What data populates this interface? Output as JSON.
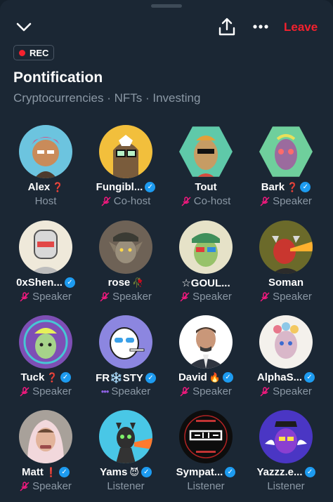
{
  "header": {
    "leave_label": "Leave",
    "rec_label": "REC"
  },
  "space": {
    "title": "Pontification",
    "topics": "Cryptocurrencies · NFTs · Investing"
  },
  "icons": {
    "collapse": "chevron-down-icon",
    "share": "share-icon",
    "more": "more-dots-icon",
    "muted": "mic-off-icon",
    "verified": "verified-badge-icon"
  },
  "colors": {
    "leave": "#f4212e",
    "muted_mic": "#f91880",
    "verified": "#1d9bf0",
    "speaking": "#8e62e3"
  },
  "participants": [
    {
      "name": "Alex",
      "emoji": "❓",
      "verified": false,
      "role": "Host",
      "mic": "none"
    },
    {
      "name": "Fungibl...",
      "emoji": "",
      "verified": true,
      "role": "Co-host",
      "mic": "muted"
    },
    {
      "name": "Tout",
      "emoji": "",
      "verified": false,
      "role": "Co-host",
      "mic": "muted"
    },
    {
      "name": "Bark",
      "emoji": "❓",
      "verified": true,
      "role": "Speaker",
      "mic": "muted"
    },
    {
      "name": "0xShen...",
      "emoji": "",
      "verified": true,
      "role": "Speaker",
      "mic": "muted"
    },
    {
      "name": "rose",
      "emoji": "🥀",
      "verified": false,
      "role": "Speaker",
      "mic": "muted"
    },
    {
      "name": "☆GOUL...",
      "emoji": "",
      "verified": false,
      "role": "Speaker",
      "mic": "muted"
    },
    {
      "name": "Soman",
      "emoji": "",
      "verified": false,
      "role": "Speaker",
      "mic": "muted"
    },
    {
      "name": "Tuck",
      "emoji": "❓",
      "verified": true,
      "role": "Speaker",
      "mic": "muted"
    },
    {
      "name": "FR❄️STY",
      "emoji": "",
      "verified": true,
      "role": "Speaker",
      "mic": "speaking"
    },
    {
      "name": "David",
      "emoji": "🔥",
      "verified": true,
      "role": "Speaker",
      "mic": "muted"
    },
    {
      "name": "AlphaS...",
      "emoji": "",
      "verified": true,
      "role": "Speaker",
      "mic": "muted"
    },
    {
      "name": "Matt",
      "emoji": "❗",
      "verified": true,
      "role": "Speaker",
      "mic": "muted"
    },
    {
      "name": "Yams",
      "emoji": "😈",
      "verified": true,
      "role": "Listener",
      "mic": "none"
    },
    {
      "name": "Sympat...",
      "emoji": "",
      "verified": true,
      "role": "Listener",
      "mic": "none"
    },
    {
      "name": "Yazzz.e...",
      "emoji": "",
      "verified": true,
      "role": "Listener",
      "mic": "none"
    }
  ]
}
